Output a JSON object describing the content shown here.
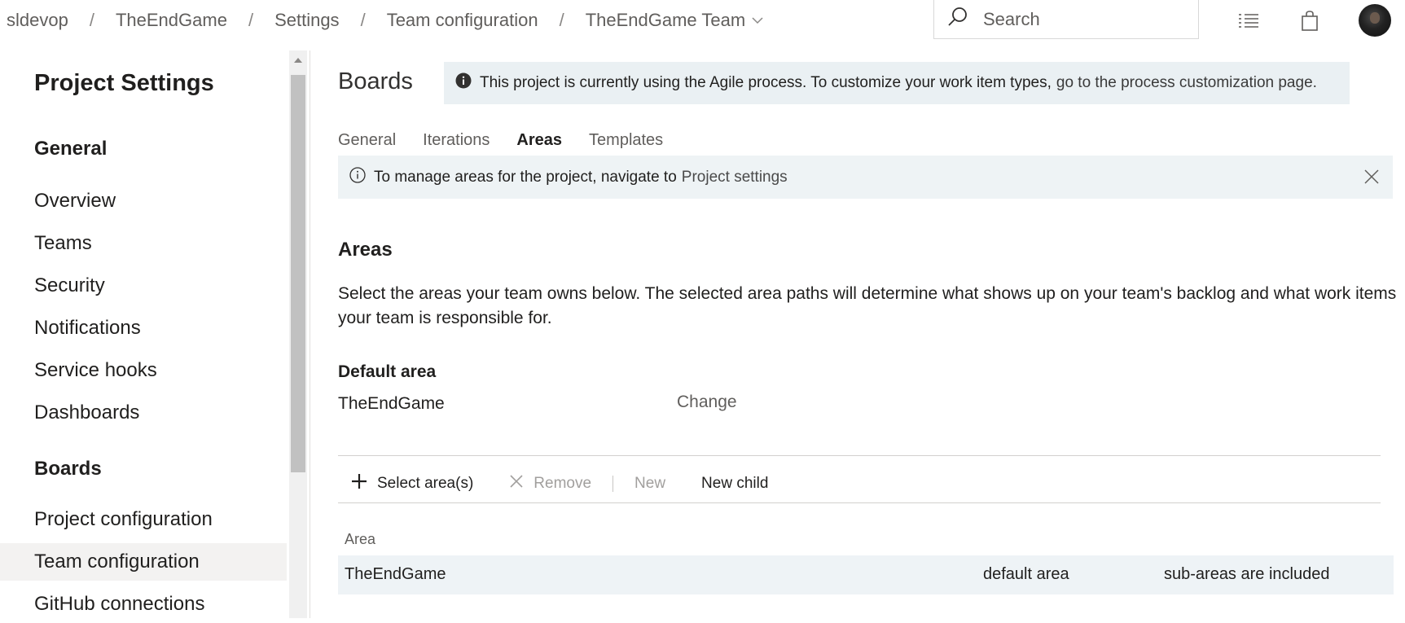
{
  "breadcrumb": {
    "items": [
      "sldevop",
      "TheEndGame",
      "Settings",
      "Team configuration"
    ],
    "separator": "/",
    "current": "TheEndGame Team"
  },
  "search": {
    "placeholder": "Search"
  },
  "top_icons": [
    "list-icon",
    "shopping-bag-icon"
  ],
  "sidebar": {
    "title": "Project Settings",
    "sections": [
      {
        "heading": "General",
        "items": [
          "Overview",
          "Teams",
          "Security",
          "Notifications",
          "Service hooks",
          "Dashboards"
        ]
      },
      {
        "heading": "Boards",
        "items": [
          "Project configuration",
          "Team configuration",
          "GitHub connections"
        ]
      }
    ],
    "selected": "Team configuration"
  },
  "main": {
    "heading": "Boards",
    "process_banner": {
      "text": "This project is currently using the Agile process. To customize your work item types,",
      "link": "go to the process customization page."
    },
    "tabs": [
      "General",
      "Iterations",
      "Areas",
      "Templates"
    ],
    "active_tab": "Areas",
    "manage_banner": {
      "text": "To manage areas for the project, navigate to",
      "link": "Project settings"
    },
    "areas": {
      "heading": "Areas",
      "description": "Select the areas your team owns below. The selected area paths will determine what shows up on your team's backlog and what work items your team is responsible for.",
      "default_label": "Default area",
      "default_value": "TheEndGame",
      "change_label": "Change"
    },
    "toolbar": {
      "select_label": "Select area(s)",
      "remove_label": "Remove",
      "new_label": "New",
      "new_child_label": "New child"
    },
    "table": {
      "header": "Area",
      "rows": [
        {
          "area": "TheEndGame",
          "type": "default area",
          "scope": "sub-areas are included"
        }
      ]
    }
  },
  "colors": {
    "banner_bg": "#eaf0f3",
    "selected_nav": "#f3f2f1",
    "row_bg": "#eef3f6"
  }
}
